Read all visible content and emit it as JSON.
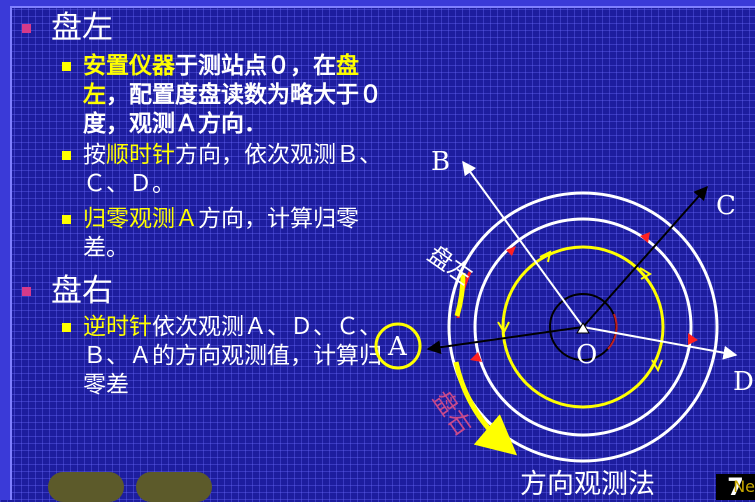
{
  "sections": [
    {
      "heading": "盘左",
      "items": [
        {
          "parts": [
            {
              "text": "安置仪器",
              "hl": true
            },
            {
              "text": "于测站点０，在",
              "hl": false
            },
            {
              "text": "盘左",
              "hl": true
            },
            {
              "text": "，配置度盘读数为略大于０度，观测Ａ方向．",
              "hl": false
            }
          ]
        },
        {
          "parts": [
            {
              "text": "按",
              "hl": false
            },
            {
              "text": "顺时针",
              "hl": true
            },
            {
              "text": "方向，依次观测Ｂ、Ｃ、Ｄ。",
              "hl": false
            }
          ]
        },
        {
          "parts": [
            {
              "text": "归零观测Ａ",
              "hl": true
            },
            {
              "text": "方向，计算归零差。",
              "hl": false
            }
          ]
        }
      ]
    },
    {
      "heading": "盘右",
      "items": [
        {
          "parts": [
            {
              "text": "逆时针",
              "hl": true
            },
            {
              "text": "依次观测Ａ、Ｄ、Ｃ、Ｂ、Ａ的方向观测值，计算归零差",
              "hl": false
            }
          ]
        }
      ]
    }
  ],
  "diagram": {
    "label_a": "A",
    "label_b": "B",
    "label_c": "C",
    "label_d": "D",
    "label_o": "O",
    "arc_left_label": "盘左",
    "arc_right_label": "盘右"
  },
  "caption": "方向观测法",
  "page_number": "7",
  "next_ghost": "Ne"
}
